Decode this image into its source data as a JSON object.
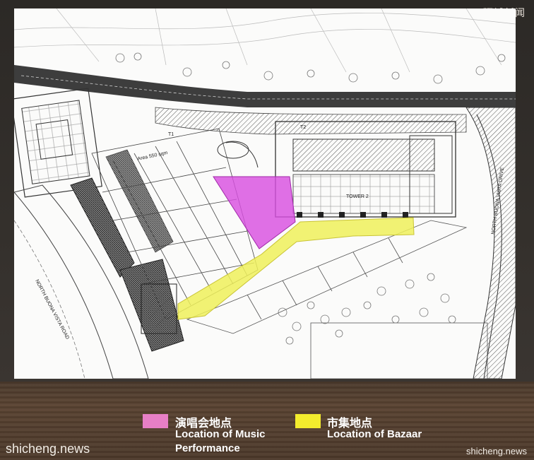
{
  "watermark_top": "狮城新闻",
  "plan": {
    "tower_label": "TOWER 2",
    "road_left": "NORTH BUONA VISTA ROAD",
    "road_right": "NORTH BUONA VISTA DRIVE",
    "area_label": "Area 550 sqm",
    "small_labels": [
      "T1",
      "T2"
    ]
  },
  "legend": {
    "music": {
      "color": "#e77fc6",
      "title_cn": "演唱会地点",
      "line1": "Location of Music",
      "line2": "Performance"
    },
    "bazaar": {
      "color": "#f3ec2d",
      "title_cn": "市集地点",
      "line1": "Location of Bazaar"
    }
  },
  "footer": {
    "left": "shicheng.news",
    "right": "shicheng.news"
  },
  "colors": {
    "music_zone": "#d84fe0",
    "bazaar_zone": "#eef05a"
  }
}
